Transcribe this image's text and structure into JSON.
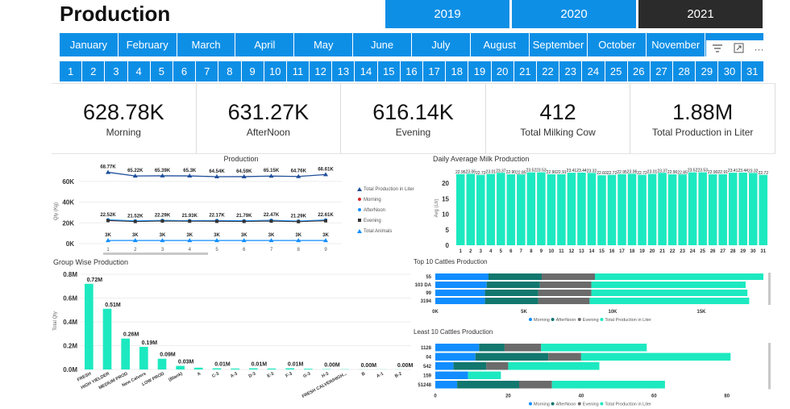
{
  "page_title": "Production",
  "years": [
    {
      "label": "2019"
    },
    {
      "label": "2020"
    },
    {
      "label": "2021"
    }
  ],
  "selected_year": "2021",
  "months": [
    {
      "label": "January"
    },
    {
      "label": "February"
    },
    {
      "label": "March"
    },
    {
      "label": "April"
    },
    {
      "label": "May"
    },
    {
      "label": "June"
    },
    {
      "label": "July"
    },
    {
      "label": "August"
    },
    {
      "label": "September"
    },
    {
      "label": "October"
    },
    {
      "label": "November"
    },
    {
      "label": ""
    }
  ],
  "days": [
    {
      "label": "1"
    },
    {
      "label": "2"
    },
    {
      "label": "3"
    },
    {
      "label": "4"
    },
    {
      "label": "5"
    },
    {
      "label": "6"
    },
    {
      "label": "7"
    },
    {
      "label": "8"
    },
    {
      "label": "9"
    },
    {
      "label": "10"
    },
    {
      "label": "11"
    },
    {
      "label": "12"
    },
    {
      "label": "13"
    },
    {
      "label": "14"
    },
    {
      "label": "15"
    },
    {
      "label": "16"
    },
    {
      "label": "17"
    },
    {
      "label": "18"
    },
    {
      "label": "19"
    },
    {
      "label": "20"
    },
    {
      "label": "21"
    },
    {
      "label": "22"
    },
    {
      "label": "23"
    },
    {
      "label": "24"
    },
    {
      "label": "25"
    },
    {
      "label": "26"
    },
    {
      "label": "27"
    },
    {
      "label": "28"
    },
    {
      "label": "29"
    },
    {
      "label": "30"
    },
    {
      "label": "31"
    }
  ],
  "visual_icons": {
    "filter": "filter-icon",
    "focus": "focus-mode-icon",
    "more": "more-options-icon",
    "more_glyph": "···"
  },
  "kpis": [
    {
      "value": "628.78K",
      "label": "Morning"
    },
    {
      "value": "631.27K",
      "label": "AfterNoon"
    },
    {
      "value": "616.14K",
      "label": "Evening"
    },
    {
      "value": "412",
      "label": "Total Milking Cow"
    },
    {
      "value": "1.88M",
      "label": "Total Production in Liter"
    }
  ],
  "colors": {
    "accent": "#0e8fe6",
    "selected": "#2b2b2b",
    "teal": "#1de9c0",
    "blue": "#118dff",
    "dark_teal": "#12776e",
    "gray": "#6b6b6b",
    "navy": "#1f4e9b",
    "red": "#d62728"
  },
  "chart_data": [
    {
      "id": "production",
      "type": "line",
      "title": "Production",
      "ylabel": "Qty (Kg)",
      "x": [
        1,
        2,
        3,
        4,
        5,
        6,
        7,
        8,
        9
      ],
      "ylim": [
        0,
        70000
      ],
      "yticks": [
        "60K",
        "40K",
        "20K",
        "0K"
      ],
      "ytick_values": [
        60000,
        40000,
        20000,
        0
      ],
      "legend": [
        "Total Production in Liter",
        "Morning",
        "AfterNoon",
        "Evening",
        "Total Animals"
      ],
      "series": [
        {
          "name": "Total Production in Liter",
          "values": [
            68770,
            65220,
            65390,
            65300,
            64540,
            64590,
            65150,
            64760,
            66610
          ],
          "labels": [
            "68.77K",
            "65.22K",
            "65.39K",
            "65.3K",
            "64.54K",
            "64.59K",
            "65.15K",
            "64.76K",
            "66.61K"
          ]
        },
        {
          "name": "Morning",
          "values": [
            22520,
            21520,
            22290,
            21930,
            22170,
            21790,
            22470,
            21290,
            22610
          ],
          "labels": [
            "22.52K",
            "21.52K",
            "22.29K",
            "21.93K",
            "22.17K",
            "21.79K",
            "22.47K",
            "21.29K",
            "22.61K"
          ]
        },
        {
          "name": "AfterNoon",
          "values": [
            23000,
            22000,
            22500,
            22200,
            22400,
            22100,
            22600,
            21800,
            22800
          ]
        },
        {
          "name": "Evening",
          "values": [
            22200,
            21300,
            21800,
            21600,
            21500,
            21400,
            21700,
            21200,
            22000
          ]
        },
        {
          "name": "Total Animals",
          "values": [
            3000,
            3000,
            3000,
            3000,
            3000,
            3000,
            3000,
            3000,
            3000
          ],
          "labels": [
            "3K",
            "3K",
            "3K",
            "3K",
            "3K",
            "3K",
            "3K",
            "3K",
            "3K"
          ]
        }
      ]
    },
    {
      "id": "daily_avg",
      "type": "bar",
      "title": "Daily Average Milk Production",
      "ylabel": "Avg (Ltr)",
      "categories": [
        "1",
        "2",
        "3",
        "4",
        "5",
        "6",
        "7",
        "8",
        "9",
        "10",
        "11",
        "12",
        "13",
        "14",
        "15",
        "16",
        "17",
        "18",
        "19",
        "20",
        "21",
        "22",
        "23",
        "24",
        "25",
        "26",
        "27",
        "28",
        "29",
        "30",
        "31"
      ],
      "values": [
        22.95,
        23.06,
        22.72,
        23.01,
        23.37,
        22.9,
        22.85,
        23.52,
        23.53,
        22.9,
        22.91,
        23.41,
        23.44,
        23.32,
        22.6,
        22.72,
        22.95,
        23.06,
        22.72,
        23.01,
        23.37,
        22.9,
        22.85,
        23.52,
        23.53,
        22.9,
        22.91,
        23.41,
        23.44,
        23.32,
        22.72
      ],
      "labels": [
        "22.95",
        "23.06",
        "22.72",
        "23.01",
        "23.37",
        "22.90",
        "22.85",
        "23.52",
        "23.53",
        "22.90",
        "22.91",
        "23.41",
        "23.44",
        "23.32",
        "22.60",
        "22.72",
        "22.95",
        "23.06",
        "22.72",
        "23.01",
        "23.37",
        "22.90",
        "22.85",
        "23.52",
        "23.53",
        "22.90",
        "22.91",
        "23.41",
        "23.44",
        "23.32",
        "22.72"
      ],
      "ylim": [
        0,
        25
      ],
      "yticks": [
        "20",
        "15",
        "10",
        "5",
        "0"
      ],
      "ytick_values": [
        20,
        15,
        10,
        5,
        0
      ]
    },
    {
      "id": "group_wise",
      "type": "bar",
      "title": "Group Wise Production",
      "ylabel": "Total Qty",
      "categories": [
        "FRESH",
        "HIGH YIELDER",
        "MEDIUM PROD",
        "New Calvers",
        "LOW PROD",
        "(Blank)",
        "A",
        "C-3",
        "A-3",
        "D-3",
        "E-3",
        "F-3",
        "G-3",
        "H-3",
        "FRESH CALVER/HIGH...",
        "B",
        "A-1",
        "B-2"
      ],
      "values": [
        0.72,
        0.51,
        0.26,
        0.19,
        0.09,
        0.03,
        0.015,
        0.01,
        0.008,
        0.01,
        0.008,
        0.01,
        0.006,
        0.003,
        0.002,
        0.001,
        0.001,
        0.001
      ],
      "labels": [
        "0.72M",
        "0.51M",
        "0.26M",
        "0.19M",
        "0.09M",
        "0.03M",
        "",
        "0.01M",
        "",
        "0.01M",
        "",
        "0.01M",
        "",
        "0.00M",
        "",
        "0.00M",
        "",
        "0.00M"
      ],
      "ylim": [
        0,
        0.8
      ],
      "yticks": [
        "0.8M",
        "0.6M",
        "0.4M",
        "0.2M",
        "0.0M"
      ],
      "ytick_values": [
        0.8,
        0.6,
        0.4,
        0.2,
        0.0
      ]
    },
    {
      "id": "top10",
      "type": "bar",
      "orientation": "horizontal",
      "stacked": true,
      "title": "Top 10 Cattles Production",
      "categories": [
        "55",
        "103 DA",
        "99",
        "3194"
      ],
      "series": [
        {
          "name": "Morning",
          "values": [
            3000,
            2900,
            2800,
            2800
          ]
        },
        {
          "name": "AfterNoon",
          "values": [
            3000,
            3000,
            3000,
            3000
          ]
        },
        {
          "name": "Evening",
          "values": [
            3000,
            2900,
            3000,
            2900
          ]
        },
        {
          "name": "Total Production in Liter",
          "values": [
            9500,
            8700,
            8800,
            9000
          ]
        }
      ],
      "xlim": [
        0,
        18500
      ],
      "xticks": [
        "0K",
        "5K",
        "10K",
        "15K"
      ],
      "xtick_values": [
        0,
        5000,
        10000,
        15000
      ],
      "legend": [
        "Morning",
        "AfterNoon",
        "Evening",
        "Total Production in Liter"
      ]
    },
    {
      "id": "least10",
      "type": "bar",
      "orientation": "horizontal",
      "stacked": true,
      "title": "Least 10 Cattles Production",
      "categories": [
        "1128",
        "04",
        "542",
        "159",
        "51248"
      ],
      "series": [
        {
          "name": "Morning",
          "values": [
            12,
            11,
            5,
            9,
            6
          ]
        },
        {
          "name": "AfterNoon",
          "values": [
            7,
            20,
            9,
            0,
            17
          ]
        },
        {
          "name": "Evening",
          "values": [
            10,
            9,
            6,
            0,
            9
          ]
        },
        {
          "name": "Total Production in Liter",
          "values": [
            29,
            41,
            25,
            9,
            31
          ]
        }
      ],
      "xlim": [
        0,
        90
      ],
      "xticks": [
        "0",
        "20",
        "40",
        "60",
        "80"
      ],
      "xtick_values": [
        0,
        20,
        40,
        60,
        80
      ],
      "legend": [
        "Morning",
        "AfterNoon",
        "Evening",
        "Total Production in Liter"
      ]
    }
  ]
}
